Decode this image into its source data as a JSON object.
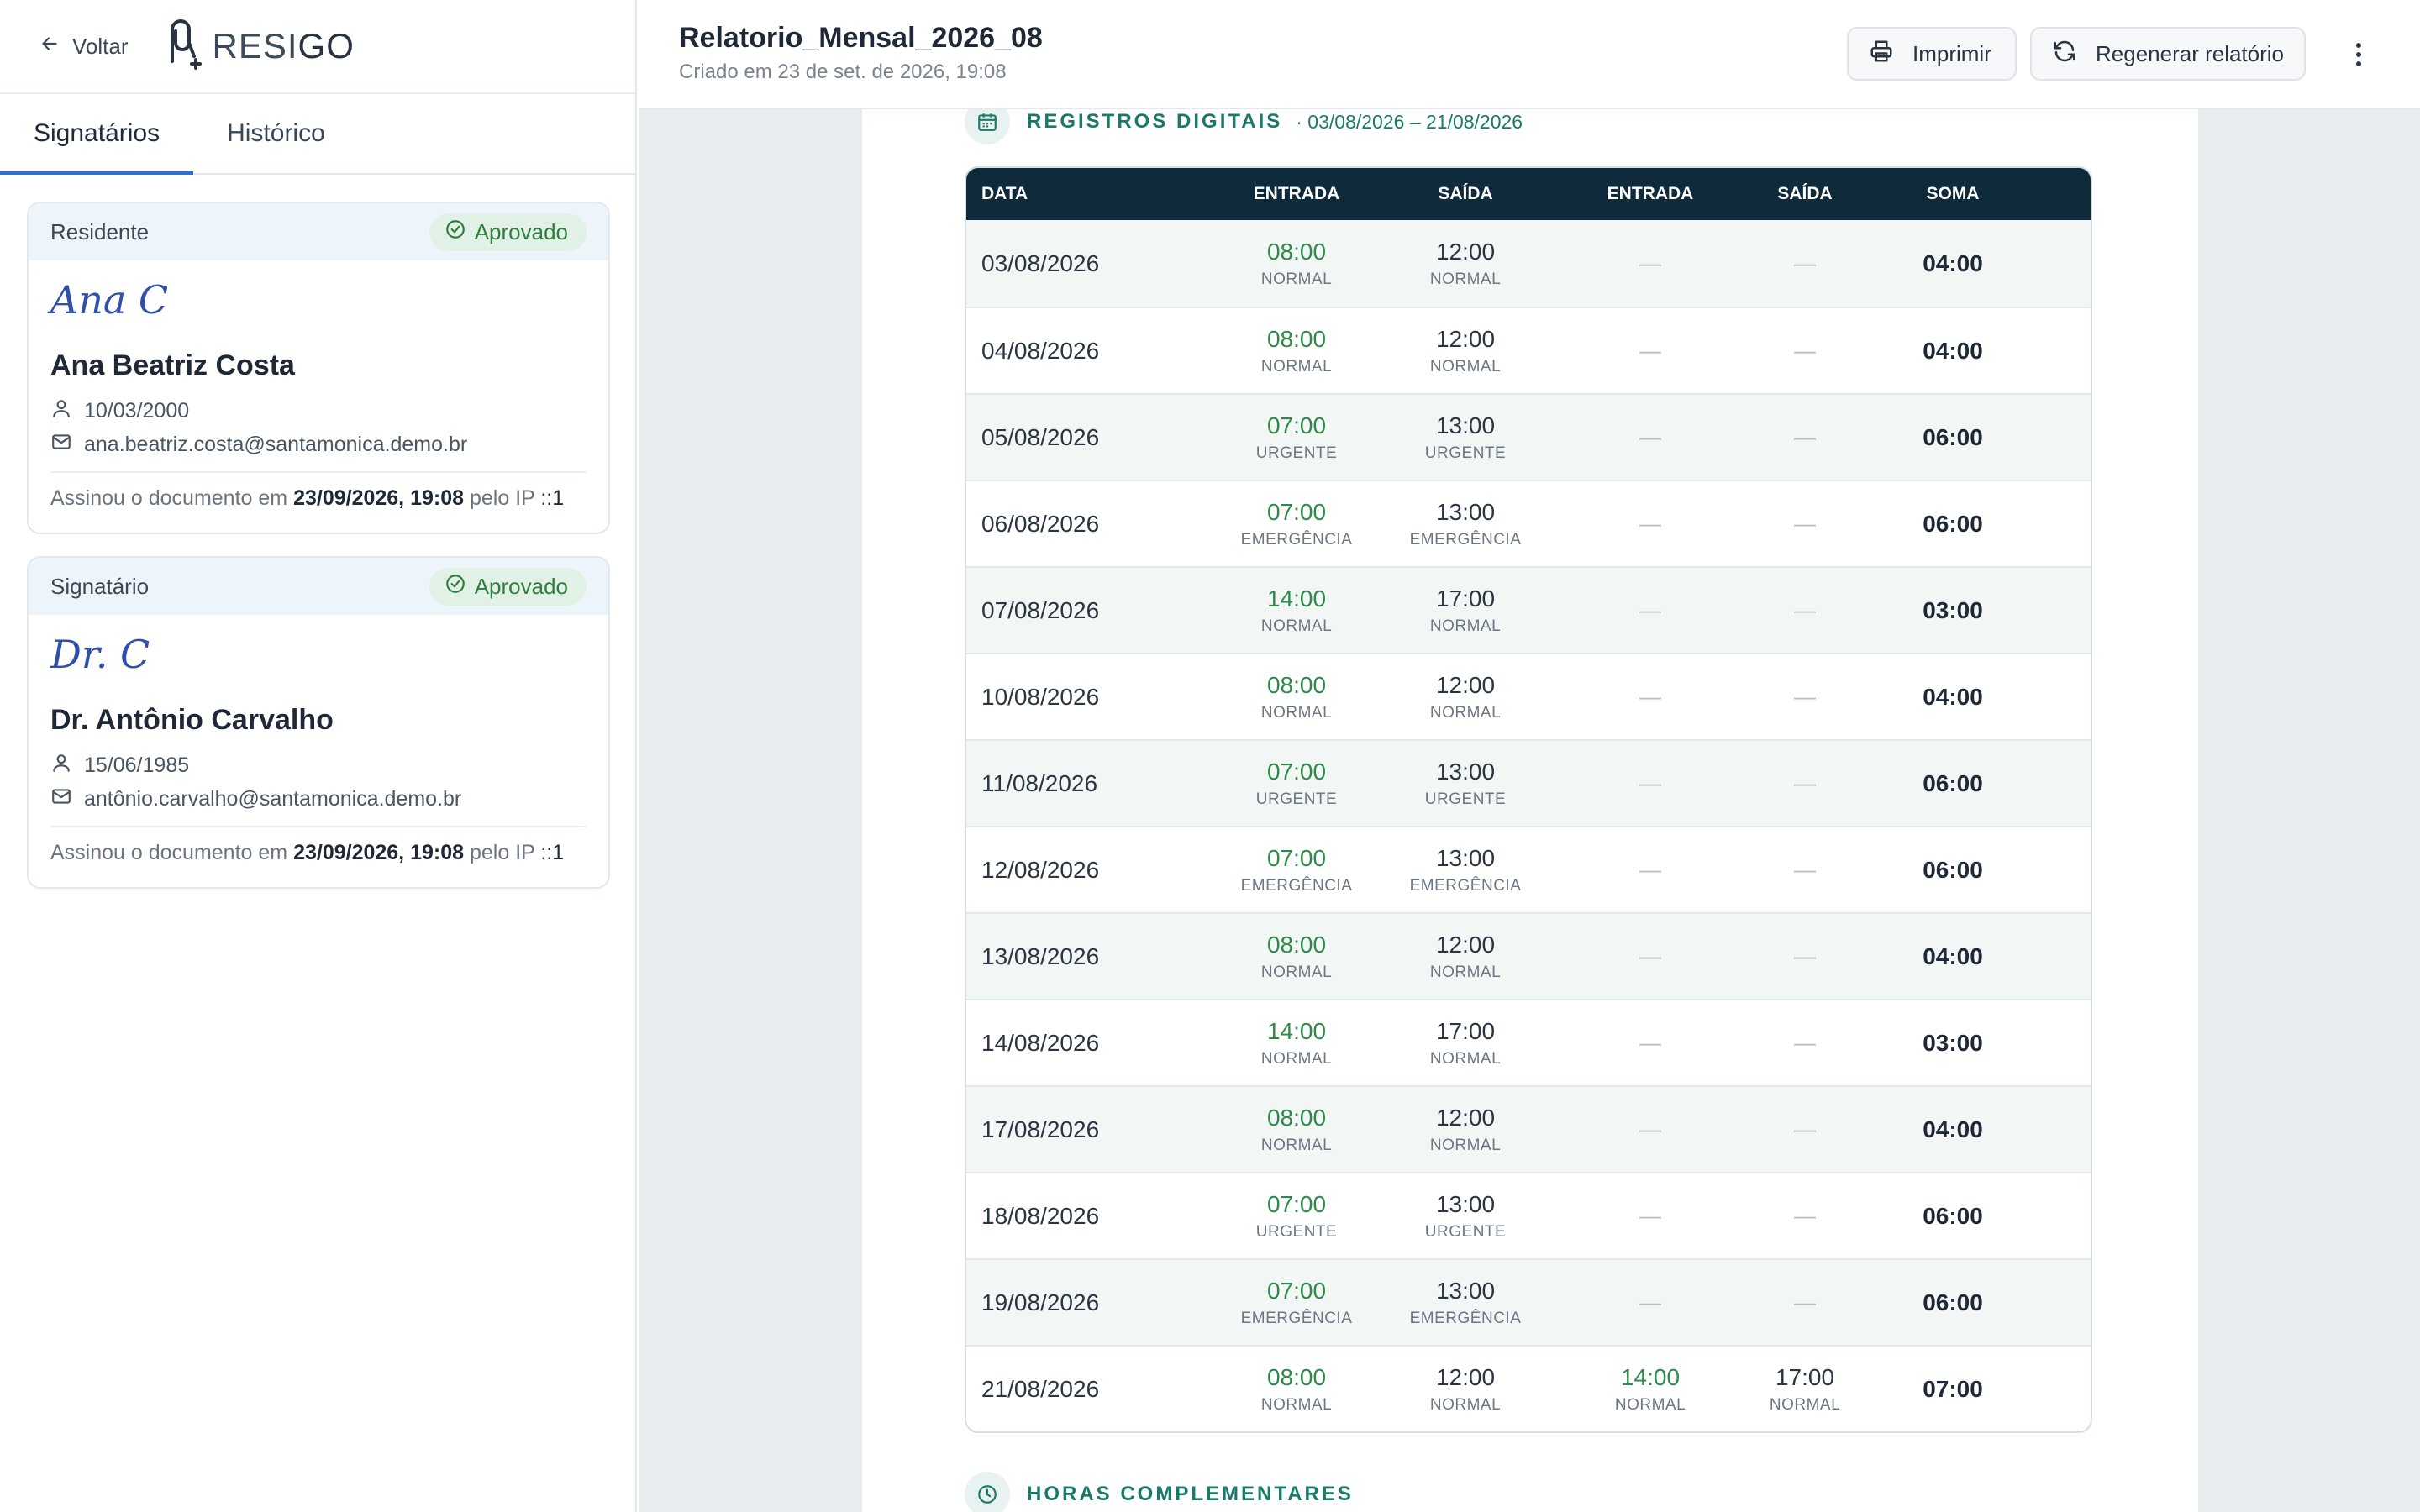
{
  "nav": {
    "back_label": "Voltar",
    "logo_text_a": "RESI",
    "logo_text_b": "GO"
  },
  "tabs": [
    {
      "label": "Signatários"
    },
    {
      "label": "Histórico"
    }
  ],
  "signers": [
    {
      "role": "Residente",
      "status": "Aprovado",
      "signature": "Ana C",
      "name": "Ana Beatriz Costa",
      "birth": "10/03/2000",
      "email": "ana.beatriz.costa@santamonica.demo.br",
      "signed_prefix": "Assinou o documento em",
      "signed_at": "23/09/2026, 19:08",
      "ip_prefix": "pelo IP",
      "ip": "::1"
    },
    {
      "role": "Signatário",
      "status": "Aprovado",
      "signature": "Dr. C",
      "name": "Dr. Antônio Carvalho",
      "birth": "15/06/1985",
      "email": "antônio.carvalho@santamonica.demo.br",
      "signed_prefix": "Assinou o documento em",
      "signed_at": "23/09/2026, 19:08",
      "ip_prefix": "pelo IP",
      "ip": "::1"
    }
  ],
  "document": {
    "title": "Relatorio_Mensal_2026_08",
    "subtitle": "Criado em 23 de set. de 2026, 19:08",
    "print_label": "Imprimir",
    "regen_label": "Regenerar relatório"
  },
  "section_records": {
    "title": "REGISTROS DIGITAIS",
    "range": "· 03/08/2026 – 21/08/2026"
  },
  "section_extra": {
    "title": "HORAS COMPLEMENTARES"
  },
  "table": {
    "headers": [
      "DATA",
      "ENTRADA",
      "SAÍDA",
      "ENTRADA",
      "SAÍDA",
      "SOMA"
    ],
    "empty": "—",
    "rows": [
      {
        "date": "03/08/2026",
        "in1": "08:00",
        "in1_kind": "NORMAL",
        "out1": "12:00",
        "out1_kind": "NORMAL",
        "in2": "—",
        "in2_kind": "",
        "out2": "—",
        "out2_kind": "",
        "sum": "04:00"
      },
      {
        "date": "04/08/2026",
        "in1": "08:00",
        "in1_kind": "NORMAL",
        "out1": "12:00",
        "out1_kind": "NORMAL",
        "in2": "—",
        "in2_kind": "",
        "out2": "—",
        "out2_kind": "",
        "sum": "04:00"
      },
      {
        "date": "05/08/2026",
        "in1": "07:00",
        "in1_kind": "URGENTE",
        "out1": "13:00",
        "out1_kind": "URGENTE",
        "in2": "—",
        "in2_kind": "",
        "out2": "—",
        "out2_kind": "",
        "sum": "06:00"
      },
      {
        "date": "06/08/2026",
        "in1": "07:00",
        "in1_kind": "EMERGÊNCIA",
        "out1": "13:00",
        "out1_kind": "EMERGÊNCIA",
        "in2": "—",
        "in2_kind": "",
        "out2": "—",
        "out2_kind": "",
        "sum": "06:00"
      },
      {
        "date": "07/08/2026",
        "in1": "14:00",
        "in1_kind": "NORMAL",
        "out1": "17:00",
        "out1_kind": "NORMAL",
        "in2": "—",
        "in2_kind": "",
        "out2": "—",
        "out2_kind": "",
        "sum": "03:00"
      },
      {
        "date": "10/08/2026",
        "in1": "08:00",
        "in1_kind": "NORMAL",
        "out1": "12:00",
        "out1_kind": "NORMAL",
        "in2": "—",
        "in2_kind": "",
        "out2": "—",
        "out2_kind": "",
        "sum": "04:00"
      },
      {
        "date": "11/08/2026",
        "in1": "07:00",
        "in1_kind": "URGENTE",
        "out1": "13:00",
        "out1_kind": "URGENTE",
        "in2": "—",
        "in2_kind": "",
        "out2": "—",
        "out2_kind": "",
        "sum": "06:00"
      },
      {
        "date": "12/08/2026",
        "in1": "07:00",
        "in1_kind": "EMERGÊNCIA",
        "out1": "13:00",
        "out1_kind": "EMERGÊNCIA",
        "in2": "—",
        "in2_kind": "",
        "out2": "—",
        "out2_kind": "",
        "sum": "06:00"
      },
      {
        "date": "13/08/2026",
        "in1": "08:00",
        "in1_kind": "NORMAL",
        "out1": "12:00",
        "out1_kind": "NORMAL",
        "in2": "—",
        "in2_kind": "",
        "out2": "—",
        "out2_kind": "",
        "sum": "04:00"
      },
      {
        "date": "14/08/2026",
        "in1": "14:00",
        "in1_kind": "NORMAL",
        "out1": "17:00",
        "out1_kind": "NORMAL",
        "in2": "—",
        "in2_kind": "",
        "out2": "—",
        "out2_kind": "",
        "sum": "03:00"
      },
      {
        "date": "17/08/2026",
        "in1": "08:00",
        "in1_kind": "NORMAL",
        "out1": "12:00",
        "out1_kind": "NORMAL",
        "in2": "—",
        "in2_kind": "",
        "out2": "—",
        "out2_kind": "",
        "sum": "04:00"
      },
      {
        "date": "18/08/2026",
        "in1": "07:00",
        "in1_kind": "URGENTE",
        "out1": "13:00",
        "out1_kind": "URGENTE",
        "in2": "—",
        "in2_kind": "",
        "out2": "—",
        "out2_kind": "",
        "sum": "06:00"
      },
      {
        "date": "19/08/2026",
        "in1": "07:00",
        "in1_kind": "EMERGÊNCIA",
        "out1": "13:00",
        "out1_kind": "EMERGÊNCIA",
        "in2": "—",
        "in2_kind": "",
        "out2": "—",
        "out2_kind": "",
        "sum": "06:00"
      },
      {
        "date": "21/08/2026",
        "in1": "08:00",
        "in1_kind": "NORMAL",
        "out1": "12:00",
        "out1_kind": "NORMAL",
        "in2": "14:00",
        "in2_kind": "NORMAL",
        "out2": "17:00",
        "out2_kind": "NORMAL",
        "sum": "07:00"
      }
    ]
  },
  "colors": {
    "accent": "#2f6fd6",
    "approved": "#2f7d3f",
    "teal": "#1a7a6a",
    "table_head": "#0e2a3b",
    "time_in": "#2f8a4a"
  }
}
